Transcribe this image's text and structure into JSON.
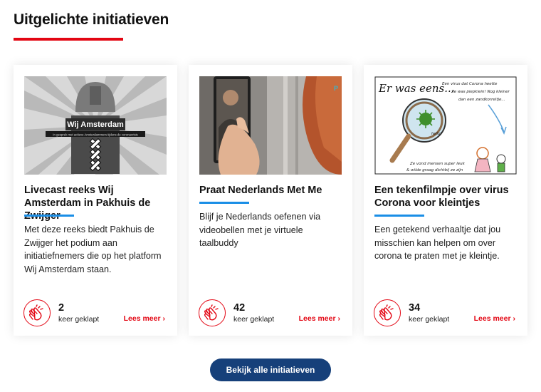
{
  "section": {
    "title": "Uitgelichte initiatieven"
  },
  "accent_colors": {
    "red": "#e30613",
    "blue": "#1a8ee6",
    "navy": "#16407a"
  },
  "cards": [
    {
      "image_text": {
        "title": "Wij Amsterdam",
        "subtitle": "In gesprek met actieve Amsterdammers tijdens de coronacrisis"
      },
      "title": "Livecast reeks Wij Amsterdam in Pakhuis de Zwijger",
      "description": "Met deze reeks biedt Pakhuis de Zwijger het podium aan initiatiefnemers die op het platform Wij Amsterdam staan.",
      "claps": "2",
      "claps_label": "keer geklapt",
      "more": "Lees meer ›",
      "icon": "clapping-hands-icon"
    },
    {
      "title": "Praat Nederlands Met Me",
      "description": "Blijf je Nederlands oefenen via videobellen met je virtuele taalbuddy",
      "claps": "42",
      "claps_label": "keer geklapt",
      "more": "Lees meer ›",
      "icon": "clapping-hands-icon"
    },
    {
      "image_text": {
        "intro": "Er was eens...",
        "line1": "Een virus dat Corona heette",
        "line2": "Ze was piepklein! Nog kleiner",
        "line3": "dan een zandkorreltje...",
        "hello": "hello!",
        "line4": "Ze vond mensen super leuk",
        "line5": "& wilde graag dichtbij ze zijn"
      },
      "title": "Een tekenfilmpje over virus Corona voor kleintjes",
      "description": "Een getekend verhaaltje dat jou misschien kan helpen om over corona te praten met je kleintje.",
      "claps": "34",
      "claps_label": "keer geklapt",
      "more": "Lees meer ›",
      "icon": "clapping-hands-icon"
    }
  ],
  "footer": {
    "button": "Bekijk alle initiatieven"
  }
}
